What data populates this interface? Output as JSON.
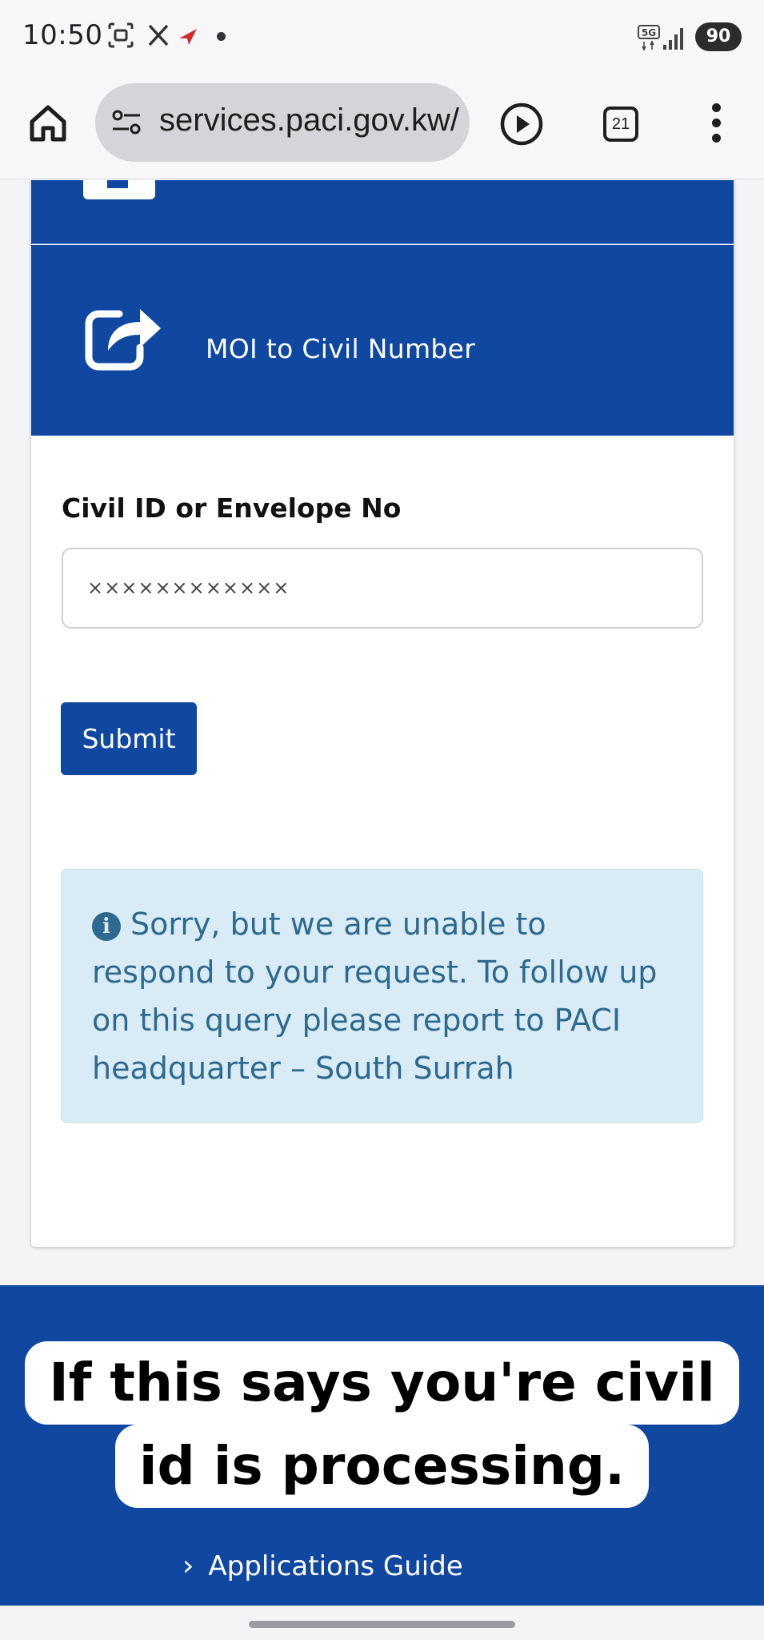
{
  "status_bar": {
    "time": "10:50",
    "network": "5G",
    "battery": "90"
  },
  "browser": {
    "url": "services.paci.gov.kw/",
    "tab_count": "21"
  },
  "card": {
    "service_label": "MOI to Civil Number",
    "field_label": "Civil ID or Envelope No",
    "field_value": "××××××××××××",
    "submit_label": "Submit",
    "alert_text": "Sorry, but we are unable to respond to your request. To follow up on this query please report to PACI headquarter – South Surrah"
  },
  "overlay_caption": {
    "line1": "If this says you're civil",
    "line2": "id is processing."
  },
  "footer": {
    "link_label": "Applications Guide"
  },
  "colors": {
    "brand_blue": "#0f47a1",
    "alert_bg": "#d9ecf5",
    "alert_text": "#2d6a8e"
  }
}
